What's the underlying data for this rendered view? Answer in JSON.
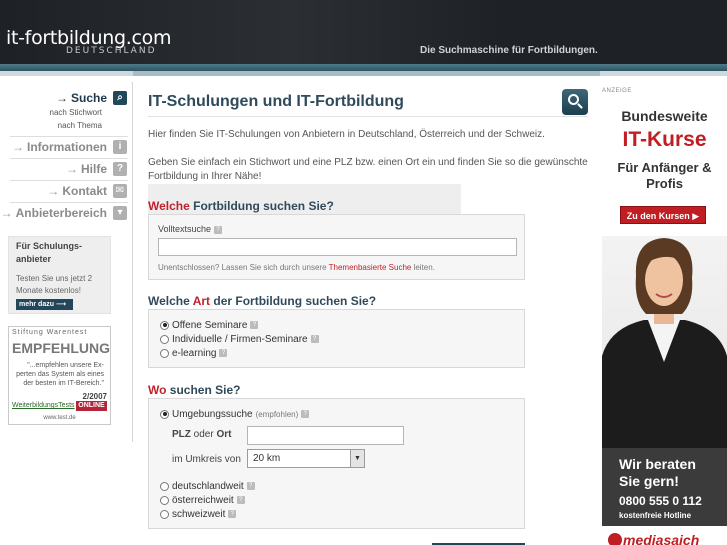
{
  "header": {
    "logo": "it-fortbildung.com",
    "logo_sub": "DEUTSCHLAND",
    "tagline": "Die Suchmaschine für Fortbildungen."
  },
  "nav": {
    "items": [
      {
        "label": "Suche",
        "icon": "magnifier-icon"
      },
      {
        "label": "Informationen",
        "icon": "info-icon"
      },
      {
        "label": "Hilfe",
        "icon": "question-icon"
      },
      {
        "label": "Kontakt",
        "icon": "mail-icon"
      },
      {
        "label": "Anbieterbereich",
        "icon": "lock-icon"
      }
    ],
    "sub_items": [
      "nach Stichwort",
      "nach Thema"
    ]
  },
  "promo": {
    "title": "Für Schulungs-anbieter",
    "text": "Testen Sie uns jetzt 2 Monate kostenlos!",
    "button": "mehr dazu"
  },
  "warentest": {
    "header": "Stiftung Warentest",
    "headline": "EMPFEHLUNG",
    "quote": "\"...empfehlen unsere Ex-perten das System als eines der besten im IT-Bereich.\"",
    "brand": "WeiterbildungsTests",
    "issue": "2/2007",
    "badge": "ONLINE",
    "url": "www.test.de"
  },
  "main": {
    "title": "IT-Schulungen und IT-Fortbildung",
    "intro1": "Hier finden Sie IT-Schulungen von Anbietern in Deutschland, Österreich und der Schweiz.",
    "intro2": "Geben Sie einfach ein Stichwort und eine PLZ bzw. einen Ort ein und finden Sie so die gewünschte Fortbildung in Ihrer Nähe!"
  },
  "section1": {
    "title_red": "Welche",
    "title_rest": "Fortbildung suchen Sie?",
    "field_label": "Volltextsuche",
    "field_value": "",
    "note_pre": "Unentschlossen? Lassen Sie sich durch unsere",
    "note_link": "Themenbasierte Suche",
    "note_post": "leiten."
  },
  "section2": {
    "title_pre": "Welche",
    "title_red": "Art",
    "title_rest": "der Fortbildung suchen Sie?",
    "options": [
      "Offene Seminare",
      "Individuelle / Firmen-Seminare",
      "e-learning"
    ],
    "selected": 0
  },
  "section3": {
    "title_red": "Wo",
    "title_rest": "suchen Sie?",
    "option_local": "Umgebungssuche",
    "option_local_note": "(empfohlen)",
    "plz_bold1": "PLZ",
    "plz_mid": "oder",
    "plz_bold2": "Ort",
    "plz_value": "",
    "radius_label": "im Umkreis von",
    "radius_value": "20 km",
    "options_other": [
      "deutschlandweit",
      "österreichweit",
      "schweizweit"
    ]
  },
  "ad": {
    "label": "ANZEIGE",
    "line1": "Bundesweite",
    "line2": "IT-Kurse",
    "line3": "Für Anfänger & Profis",
    "button": "Zu den Kursen ▶",
    "cta": "Wir beraten Sie gern!",
    "phone": "0800 555 0 112",
    "hotline": "kostenfreie Hotline",
    "logo": "mediasaich"
  },
  "colors": {
    "header_bg": "#1e2126",
    "accent_teal": "#2c5564",
    "title_blue": "#2f4a5a",
    "accent_red": "#c0222c"
  }
}
